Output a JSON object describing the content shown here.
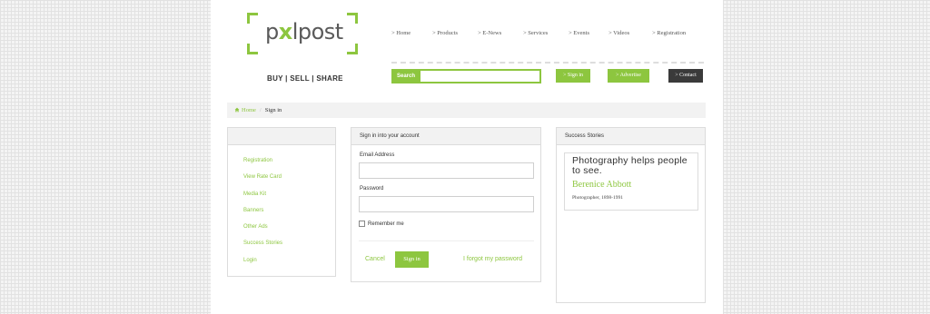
{
  "brand": {
    "logo_left": "p",
    "logo_mid": "x",
    "logo_right": "lpost",
    "tagline": "BUY |  SELL |  SHARE",
    "accent": "#8dc63f"
  },
  "nav": [
    "> Home",
    "> Products",
    "> E-News",
    "> Services",
    "> Events",
    "> Videos",
    "> Registration"
  ],
  "search": {
    "label": "Search",
    "value": ""
  },
  "actions": {
    "signin": "> Sign in",
    "advertise": "> Advertise",
    "contact": "> Contact"
  },
  "breadcrumb": {
    "home": "Home",
    "current": "Sign in"
  },
  "sidebar": {
    "heading": "",
    "links": [
      "Registration",
      "View Rate Card",
      "Media Kit",
      "Banners",
      "Other Ads",
      "Success Stories",
      "Login"
    ]
  },
  "signin_form": {
    "heading": "Sign in into your account",
    "email_label": "Email Address",
    "email_value": "",
    "password_label": "Password",
    "password_value": "",
    "remember_label": "Remember me",
    "cancel": "Cancel",
    "submit": "Sign in",
    "forgot": "I forgot my password"
  },
  "stories": {
    "heading": "Success Stories",
    "quote": "Photography helps people to see.",
    "author": "Berenice Abbott",
    "role": "Photographer, 1898-1991"
  }
}
